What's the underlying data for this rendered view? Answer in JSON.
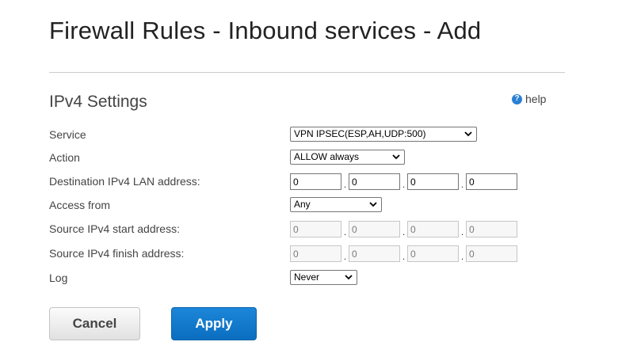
{
  "header": {
    "title": "Firewall Rules - Inbound services - Add"
  },
  "section": {
    "title": "IPv4 Settings",
    "help_label": "help",
    "help_icon": "question-circle-icon"
  },
  "form": {
    "service": {
      "label": "Service",
      "value": "VPN IPSEC(ESP,AH,UDP:500)"
    },
    "action": {
      "label": "Action",
      "value": "ALLOW always"
    },
    "dest_ip": {
      "label": "Destination IPv4 LAN address:",
      "octets": [
        "0",
        "0",
        "0",
        "0"
      ]
    },
    "access_from": {
      "label": "Access from",
      "value": "Any"
    },
    "src_start": {
      "label": "Source IPv4 start address:",
      "octets": [
        "0",
        "0",
        "0",
        "0"
      ]
    },
    "src_finish": {
      "label": "Source IPv4 finish address:",
      "octets": [
        "0",
        "0",
        "0",
        "0"
      ]
    },
    "log": {
      "label": "Log",
      "value": "Never"
    },
    "ip_separator": "."
  },
  "buttons": {
    "cancel": "Cancel",
    "apply": "Apply"
  },
  "colors": {
    "accent": "#1479cc",
    "help_icon": "#2a7fd4"
  }
}
